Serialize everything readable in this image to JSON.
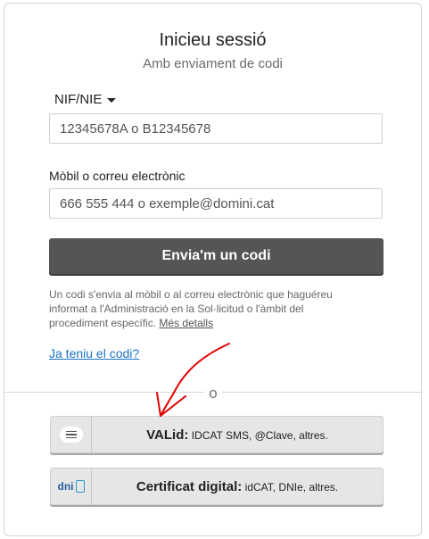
{
  "login": {
    "title": "Inicieu sessió",
    "subtitle": "Amb enviament de codi",
    "id_type": "NIF/NIE",
    "id_placeholder": "12345678A o B12345678",
    "contact_label": "Mòbil o correu electrònic",
    "contact_placeholder": "666 555 444 o exemple@domini.cat",
    "send_button": "Envia'm un codi",
    "info_text": "Un codi s'envia al mòbil o al correu electrònic que haguéreu informat a l'Administració en la Sol·licitud o l'àmbit del procediment específic.",
    "info_link": "Més detalls",
    "have_code_link": "Ja teniu el codi?",
    "separator": "o"
  },
  "alternatives": [
    {
      "name": "VALid:",
      "detail": "IDCAT SMS, @Clave, altres.",
      "icon": "chat-bubble-icon"
    },
    {
      "name": "Certificat digital:",
      "detail": "idCAT, DNIe, altres.",
      "icon": "dni-icon",
      "icon_text": "dni"
    }
  ],
  "colors": {
    "primary_button": "#555555",
    "link": "#1a73c8",
    "annotation_arrow": "#e00000"
  }
}
